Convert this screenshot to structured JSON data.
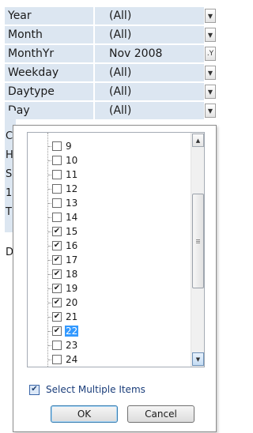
{
  "filters": [
    {
      "name": "Year",
      "value": "(All)",
      "filtered": false
    },
    {
      "name": "Month",
      "value": "(All)",
      "filtered": false
    },
    {
      "name": "MonthYr",
      "value": "Nov 2008",
      "filtered": true
    },
    {
      "name": "Weekday",
      "value": "(All)",
      "filtered": false
    },
    {
      "name": "Daytype",
      "value": "(All)",
      "filtered": false
    },
    {
      "name": "Day",
      "value": "(All)",
      "filtered": false
    }
  ],
  "left_labels": [
    "C",
    "H",
    "S",
    "1",
    "T",
    "D"
  ],
  "icons": {
    "dropdown": "chevron-down-icon",
    "filtered_dropdown": "filter-icon",
    "checkmark": "✔"
  },
  "items": [
    {
      "label": "9",
      "checked": false,
      "selected": false
    },
    {
      "label": "10",
      "checked": false,
      "selected": false
    },
    {
      "label": "11",
      "checked": false,
      "selected": false
    },
    {
      "label": "12",
      "checked": false,
      "selected": false
    },
    {
      "label": "13",
      "checked": false,
      "selected": false
    },
    {
      "label": "14",
      "checked": false,
      "selected": false
    },
    {
      "label": "15",
      "checked": true,
      "selected": false
    },
    {
      "label": "16",
      "checked": true,
      "selected": false
    },
    {
      "label": "17",
      "checked": true,
      "selected": false
    },
    {
      "label": "18",
      "checked": true,
      "selected": false
    },
    {
      "label": "19",
      "checked": true,
      "selected": false
    },
    {
      "label": "20",
      "checked": true,
      "selected": false
    },
    {
      "label": "21",
      "checked": true,
      "selected": false
    },
    {
      "label": "22",
      "checked": true,
      "selected": true
    },
    {
      "label": "23",
      "checked": false,
      "selected": false
    },
    {
      "label": "24",
      "checked": false,
      "selected": false
    }
  ],
  "select_multiple": {
    "label": "Select Multiple Items",
    "checked": true
  },
  "buttons": {
    "ok": "OK",
    "cancel": "Cancel"
  },
  "colors": {
    "field_bg": "#dce6f1",
    "selection": "#3399ff",
    "multi_label": "#1a3d7a"
  }
}
